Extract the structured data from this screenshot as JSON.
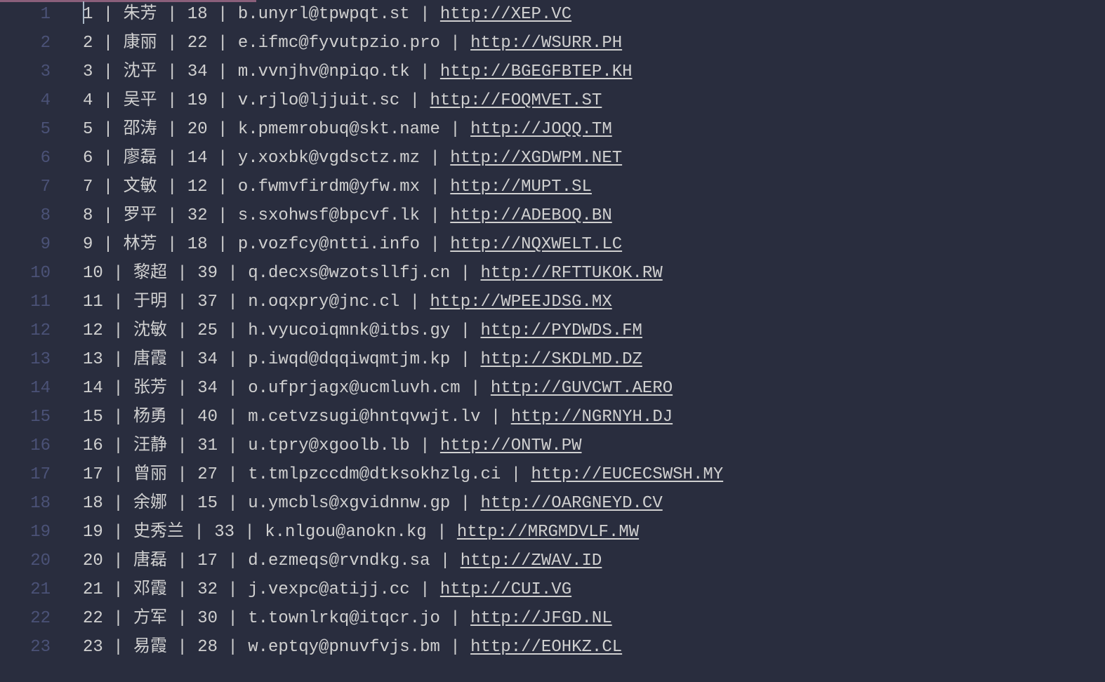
{
  "rows": [
    {
      "lineno": "1",
      "id": "1",
      "name": "朱芳",
      "age": "18",
      "email": "b.unyrl@tpwpqt.st",
      "url": "http://XEP.VC"
    },
    {
      "lineno": "2",
      "id": "2",
      "name": "康丽",
      "age": "22",
      "email": "e.ifmc@fyvutpzio.pro",
      "url": "http://WSURR.PH"
    },
    {
      "lineno": "3",
      "id": "3",
      "name": "沈平",
      "age": "34",
      "email": "m.vvnjhv@npiqo.tk",
      "url": "http://BGEGFBTEP.KH"
    },
    {
      "lineno": "4",
      "id": "4",
      "name": "吴平",
      "age": "19",
      "email": "v.rjlo@ljjuit.sc",
      "url": "http://FOQMVET.ST"
    },
    {
      "lineno": "5",
      "id": "5",
      "name": "邵涛",
      "age": "20",
      "email": "k.pmemrobuq@skt.name",
      "url": "http://JOQQ.TM"
    },
    {
      "lineno": "6",
      "id": "6",
      "name": "廖磊",
      "age": "14",
      "email": "y.xoxbk@vgdsctz.mz",
      "url": "http://XGDWPM.NET"
    },
    {
      "lineno": "7",
      "id": "7",
      "name": "文敏",
      "age": "12",
      "email": "o.fwmvfirdm@yfw.mx",
      "url": "http://MUPT.SL"
    },
    {
      "lineno": "8",
      "id": "8",
      "name": "罗平",
      "age": "32",
      "email": "s.sxohwsf@bpcvf.lk",
      "url": "http://ADEBOQ.BN"
    },
    {
      "lineno": "9",
      "id": "9",
      "name": "林芳",
      "age": "18",
      "email": "p.vozfcy@ntti.info",
      "url": "http://NQXWELT.LC"
    },
    {
      "lineno": "10",
      "id": "10",
      "name": "黎超",
      "age": "39",
      "email": "q.decxs@wzotsllfj.cn",
      "url": "http://RFTTUKOK.RW"
    },
    {
      "lineno": "11",
      "id": "11",
      "name": "于明",
      "age": "37",
      "email": "n.oqxpry@jnc.cl",
      "url": "http://WPEEJDSG.MX"
    },
    {
      "lineno": "12",
      "id": "12",
      "name": "沈敏",
      "age": "25",
      "email": "h.vyucoiqmnk@itbs.gy",
      "url": "http://PYDWDS.FM"
    },
    {
      "lineno": "13",
      "id": "13",
      "name": "唐霞",
      "age": "34",
      "email": "p.iwqd@dqqiwqmtjm.kp",
      "url": "http://SKDLMD.DZ"
    },
    {
      "lineno": "14",
      "id": "14",
      "name": "张芳",
      "age": "34",
      "email": "o.ufprjagx@ucmluvh.cm",
      "url": "http://GUVCWT.AERO"
    },
    {
      "lineno": "15",
      "id": "15",
      "name": "杨勇",
      "age": "40",
      "email": "m.cetvzsugi@hntqvwjt.lv",
      "url": "http://NGRNYH.DJ"
    },
    {
      "lineno": "16",
      "id": "16",
      "name": "汪静",
      "age": "31",
      "email": "u.tpry@xgoolb.lb",
      "url": "http://ONTW.PW"
    },
    {
      "lineno": "17",
      "id": "17",
      "name": "曾丽",
      "age": "27",
      "email": "t.tmlpzccdm@dtksokhzlg.ci",
      "url": "http://EUCECSWSH.MY"
    },
    {
      "lineno": "18",
      "id": "18",
      "name": "余娜",
      "age": "15",
      "email": "u.ymcbls@xgvidnnw.gp",
      "url": "http://OARGNEYD.CV"
    },
    {
      "lineno": "19",
      "id": "19",
      "name": "史秀兰",
      "age": "33",
      "email": "k.nlgou@anokn.kg",
      "url": "http://MRGMDVLF.MW"
    },
    {
      "lineno": "20",
      "id": "20",
      "name": "唐磊",
      "age": "17",
      "email": "d.ezmeqs@rvndkg.sa",
      "url": "http://ZWAV.ID"
    },
    {
      "lineno": "21",
      "id": "21",
      "name": "邓霞",
      "age": "32",
      "email": "j.vexpc@atijj.cc",
      "url": "http://CUI.VG"
    },
    {
      "lineno": "22",
      "id": "22",
      "name": "方军",
      "age": "30",
      "email": "t.townlrkq@itqcr.jo",
      "url": "http://JFGD.NL"
    },
    {
      "lineno": "23",
      "id": "23",
      "name": "易霞",
      "age": "28",
      "email": "w.eptqy@pnuvfvjs.bm",
      "url": "http://EOHKZ.CL"
    }
  ],
  "separator": " | ",
  "cursor_line": 1
}
